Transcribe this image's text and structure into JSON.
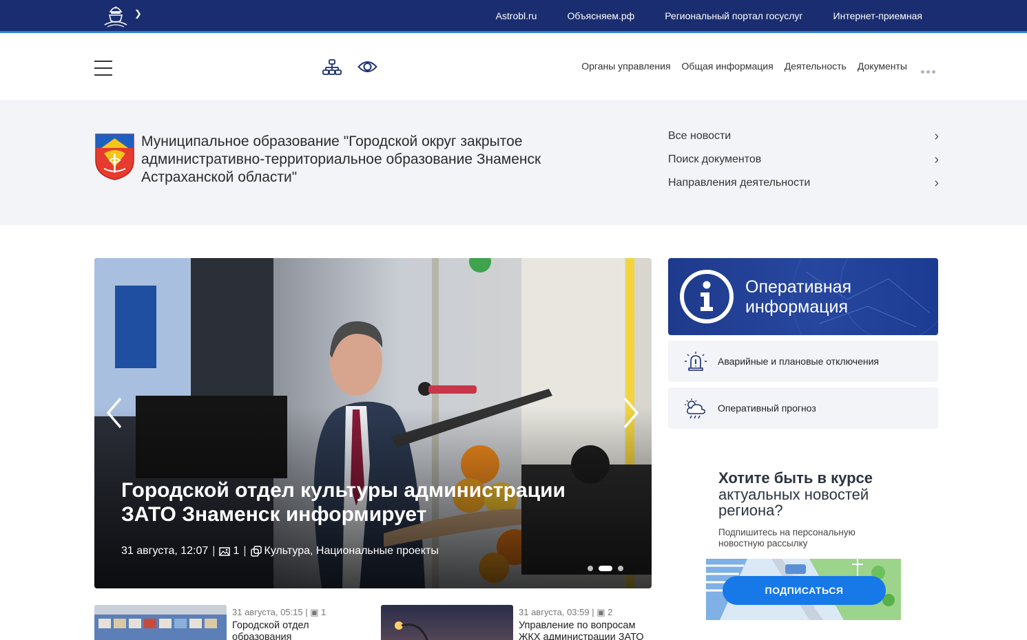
{
  "topbar": {
    "links": [
      "Astrobl.ru",
      "Объясняем.рф",
      "Региональный портал госуслуг",
      "Интернет-приемная"
    ]
  },
  "header": {
    "nav": [
      "Органы управления",
      "Общая информация",
      "Деятельность",
      "Документы"
    ]
  },
  "banner": {
    "title": "Муниципальное образование \"Городской округ закрытое административно-территориальное образование Знаменск Астраханской области\"",
    "quicklinks": [
      "Все новости",
      "Поиск документов",
      "Направления деятельности"
    ]
  },
  "slider": {
    "title": "Городской отдел культуры администрации ЗАТО Знаменск информирует",
    "date": "31 августа, 12:07",
    "photos": "1",
    "tags": "Культура, Национальные проекты",
    "dots_count": 3,
    "active_dot": 1
  },
  "right": {
    "opinfo_title": "Оперативная информация",
    "card1": "Аварийные и плановые отключения",
    "card2": "Оперативный прогноз"
  },
  "promo": {
    "heading_bold": "Хотите быть в курсе",
    "heading": "актуальных новостей региона?",
    "subtitle": "Подпишитесь на персональную новостную рассылку",
    "button": "ПОДПИСАТЬСЯ"
  },
  "news": [
    {
      "date": "31 августа, 05:15",
      "photos": "1",
      "title": "Городской отдел образования"
    },
    {
      "date": "31 августа, 03:59",
      "photos": "2",
      "title": "Управление по вопросам ЖКХ администрации ЗАТО"
    }
  ],
  "colors": {
    "topbar": "#1a2d70",
    "accent": "#2e7fd6",
    "button": "#1778e8",
    "banner_bg": "#f3f4f8"
  }
}
